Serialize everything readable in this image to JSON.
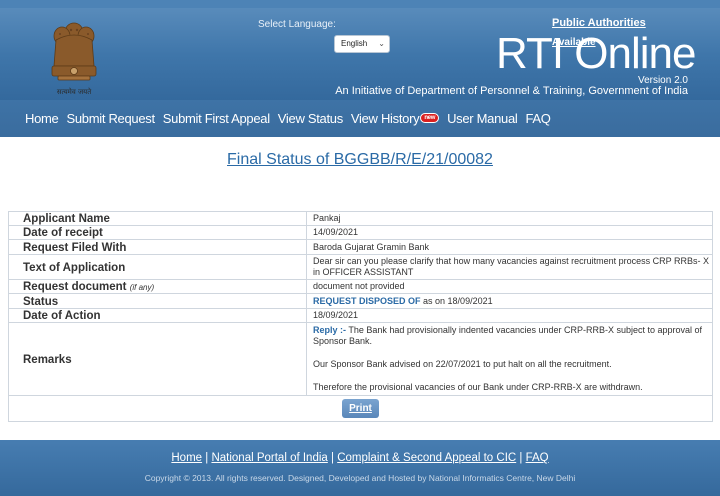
{
  "header": {
    "emblem_caption": "सत्यमेव जयते",
    "select_language_label": "Select Language:",
    "language_selected": "English",
    "public_authorities": "Public Authorities",
    "available": "Available",
    "title": "RTI Online",
    "version": "Version 2.0",
    "initiative": "An Initiative of Department of Personnel & Training, Government of India"
  },
  "nav": {
    "items": [
      {
        "label": "Home"
      },
      {
        "label": "Submit Request"
      },
      {
        "label": "Submit First Appeal"
      },
      {
        "label": "View Status"
      },
      {
        "label": "View History",
        "badge": "new"
      },
      {
        "label": "User Manual"
      },
      {
        "label": "FAQ"
      }
    ]
  },
  "main": {
    "status_title": "Final Status of   BGGBB/R/E/21/00082",
    "rows": {
      "applicant_name": {
        "label": "Applicant Name",
        "value": "Pankaj"
      },
      "date_of_receipt": {
        "label": "Date of receipt",
        "value": "14/09/2021"
      },
      "request_filed_with": {
        "label": "Request Filed With",
        "value": "Baroda Gujarat Gramin Bank"
      },
      "text_of_application": {
        "label": "Text of Application",
        "value": "Dear sir can you please clarify that how many vacancies against recruitment process CRP RRBs- X in OFFICER ASSISTANT"
      },
      "request_document": {
        "label": "Request document",
        "label_note": "(if any)",
        "value": "document not provided"
      },
      "status": {
        "label": "Status",
        "value_highlight": "REQUEST DISPOSED OF",
        "value_rest": " as on 18/09/2021"
      },
      "date_of_action": {
        "label": "Date of Action",
        "value": "18/09/2021"
      },
      "remarks": {
        "label": "Remarks",
        "reply_label": "Reply :-",
        "p1": " The Bank had provisionally indented vacancies under CRP-RRB-X subject to approval of Sponsor Bank.",
        "p2": "Our Sponsor Bank advised on 22/07/2021 to put halt on all the recruitment.",
        "p3": "Therefore the provisional vacancies of our Bank under CRP-RRB-X are withdrawn."
      }
    },
    "print_label": "Print"
  },
  "footer": {
    "links": [
      "Home",
      "National Portal of India",
      "Complaint & Second Appeal to CIC",
      "FAQ"
    ],
    "copyright": "Copyright © 2013. All rights reserved. Designed, Developed and Hosted by National Informatics Centre, New Delhi"
  }
}
